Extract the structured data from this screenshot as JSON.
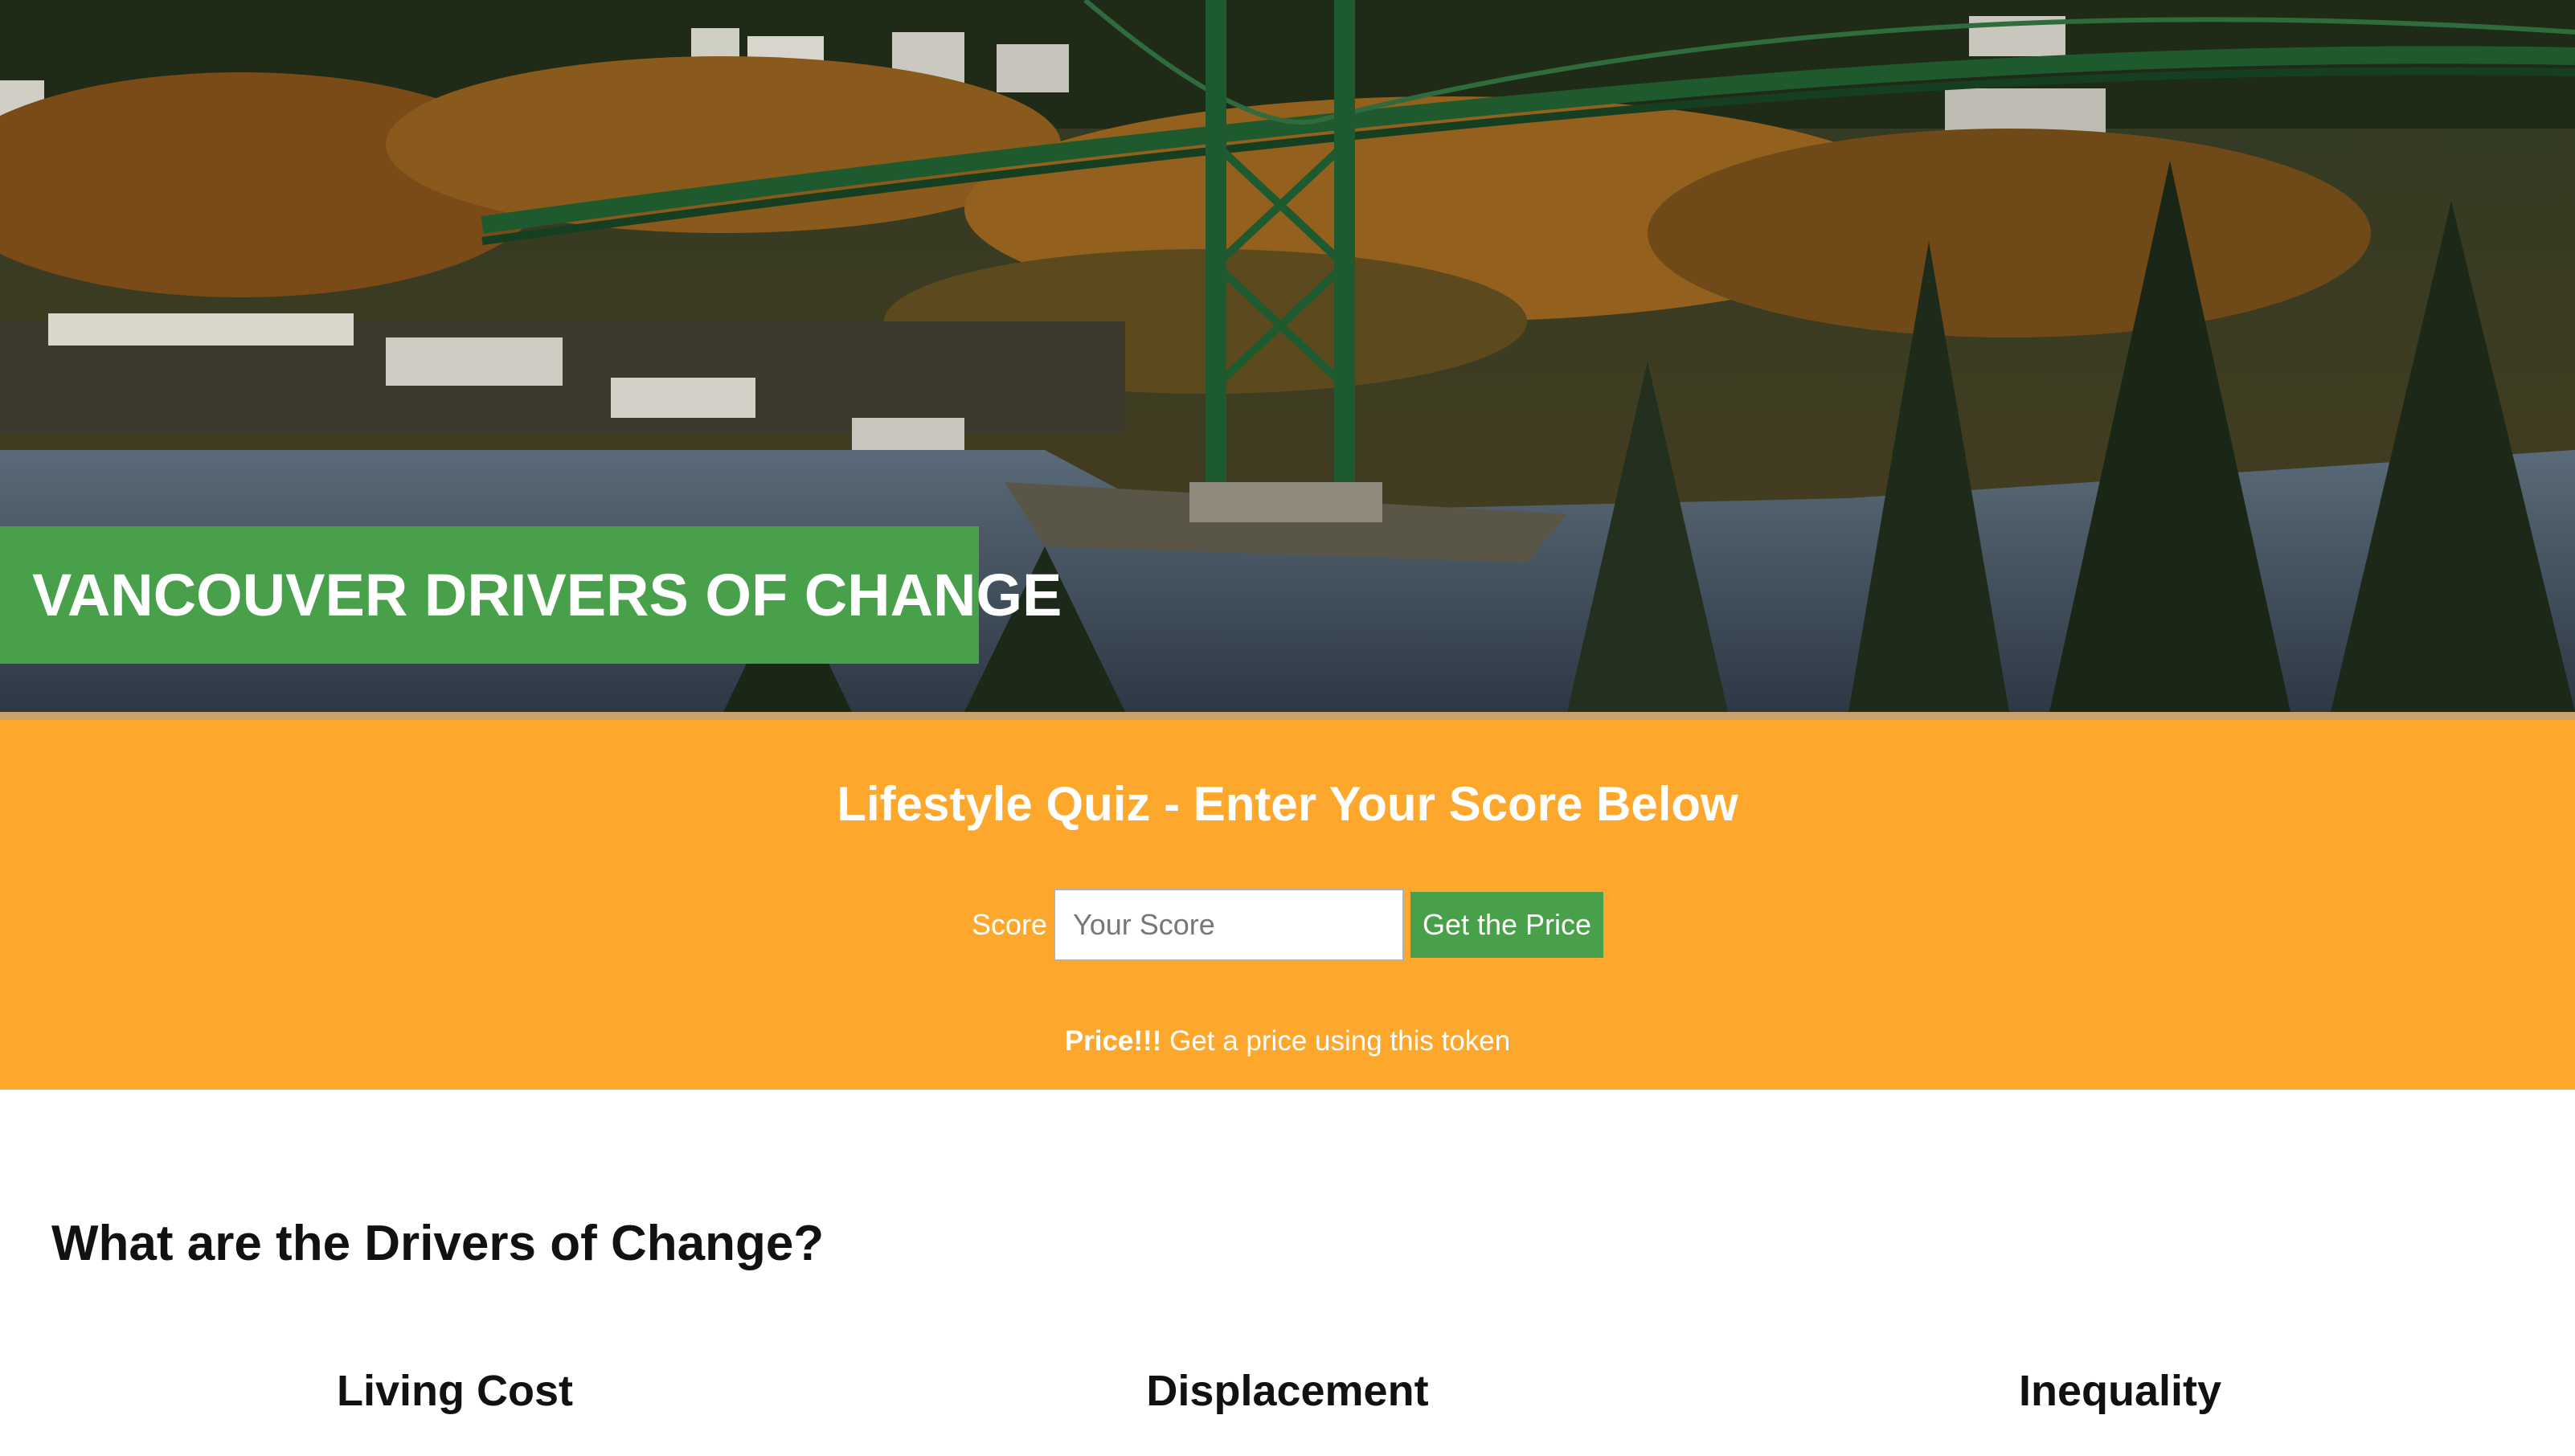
{
  "hero": {
    "title": "VANCOUVER DRIVERS OF CHANGE",
    "image_description_icon": "bridge-landscape-photo"
  },
  "quiz": {
    "heading": "Lifestyle Quiz - Enter Your Score Below",
    "score_label": "Score",
    "score_placeholder": "Your Score",
    "score_value": "",
    "button_label": "Get the Price",
    "price_strong": "Price!!!",
    "price_text": " Get a price using this token"
  },
  "drivers": {
    "heading": "What are the Drivers of Change?",
    "columns": [
      {
        "title": "Living Cost"
      },
      {
        "title": "Displacement"
      },
      {
        "title": "Inequality"
      }
    ]
  },
  "colors": {
    "accent_green": "#48a04a",
    "quiz_orange": "#fea72d",
    "text_dark": "#111111"
  }
}
